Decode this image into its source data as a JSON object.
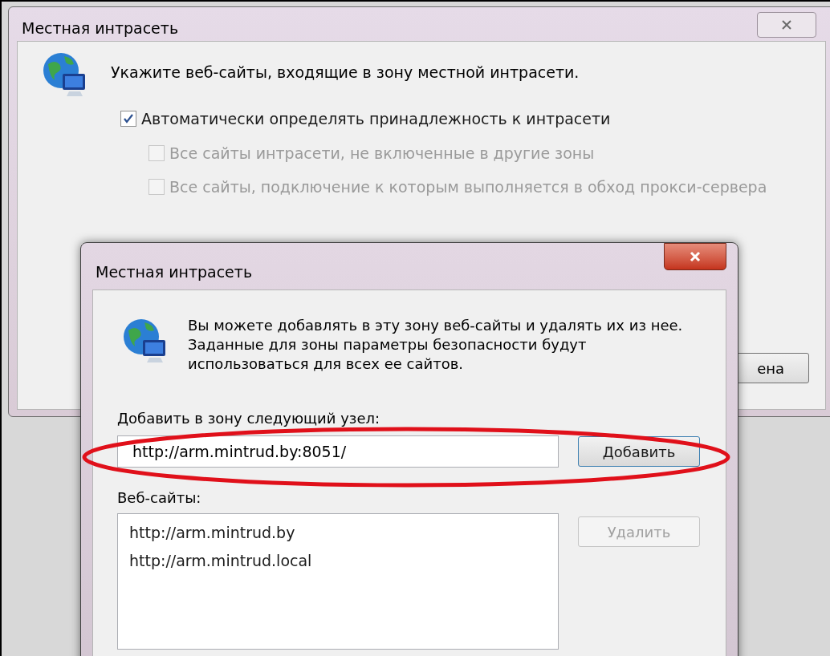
{
  "back_dialog": {
    "title": "Местная интрасеть",
    "intro": "Укажите веб-сайты, входящие в зону местной интрасети.",
    "options": [
      {
        "label": "Автоматически определять принадлежность к интрасети",
        "checked": true,
        "disabled": false,
        "children": [
          {
            "label": "Все сайты интрасети, не включенные в другие зоны",
            "checked": false,
            "disabled": true
          },
          {
            "label": "Все сайты, подключение к которым выполняется в обход прокси-сервера",
            "checked": false,
            "disabled": true
          }
        ]
      }
    ],
    "cancel_button": "ена"
  },
  "front_dialog": {
    "title": "Местная интрасеть",
    "intro": "Вы можете добавлять в эту зону  веб-сайты и удалять их из нее. Заданные для зоны параметры безопасности будут использоваться для всех ее сайтов.",
    "add_label": "Добавить в зону следующий узел:",
    "add_field": {
      "value": "http://arm.mintrud.by:8051/"
    },
    "add_button": {
      "label": "Добавить",
      "disabled": false
    },
    "sites_label": "Веб-сайты:",
    "sites": [
      {
        "label": "http://arm.mintrud.by",
        "selected": false
      },
      {
        "label": "http://arm.mintrud.local",
        "selected": false
      }
    ],
    "remove_button": {
      "label": "Удалить",
      "disabled": true
    }
  }
}
